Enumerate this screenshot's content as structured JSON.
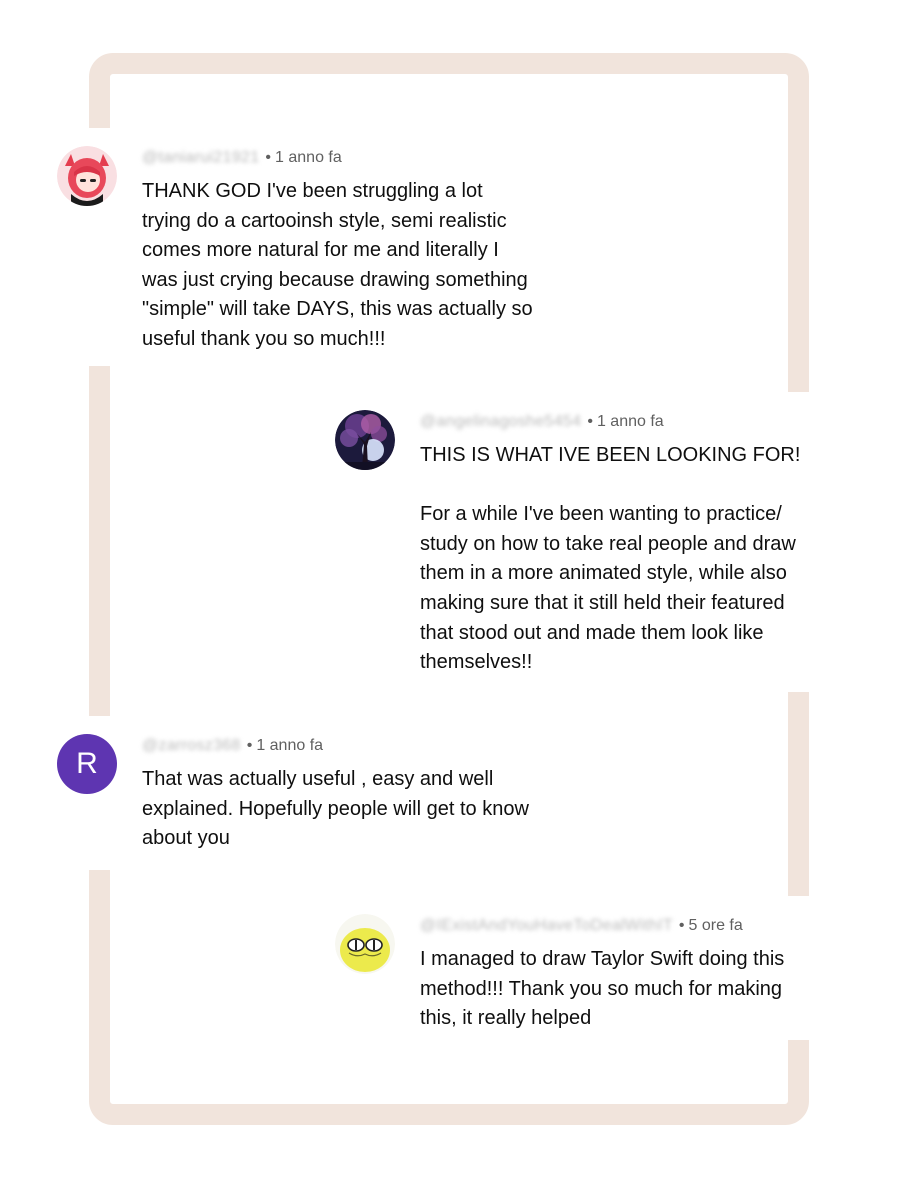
{
  "comments": [
    {
      "handle": "@taniarui21921",
      "time": "1 anno fa",
      "text": "THANK GOD I've been struggling a lot\ntrying do a cartooinsh style, semi realistic\ncomes more natural for me and literally I\nwas just crying because drawing something\n\"simple\" will take DAYS, this was actually so\nuseful thank you so much!!!",
      "avatar": "anime-girl-avatar-icon"
    },
    {
      "handle": "@angelinagoshe5454",
      "time": "1 anno fa",
      "text": "THIS IS WHAT IVE BEEN LOOKING FOR!\n\nFor a while I've been wanting to practice/\nstudy on how to take real people and draw\nthem in a more animated style, while also\nmaking sure that it still held their featured\nthat stood out and made them look like\nthemselves!!",
      "avatar": "tree-night-avatar-icon"
    },
    {
      "handle": "@zarrosz368",
      "time": "1 anno fa",
      "text": "That was actually useful , easy and well\nexplained. Hopefully people will get to know\nabout you",
      "avatar_letter": "R",
      "avatar_color": "#5e35b1"
    },
    {
      "handle": "@IExistAndYouHaveToDealWithIT",
      "time": "5 ore fa",
      "text": "I managed to draw Taylor Swift doing this\nmethod!!! Thank you so much for making\nthis, it really helped",
      "avatar": "yellow-cartoon-avatar-icon"
    }
  ]
}
